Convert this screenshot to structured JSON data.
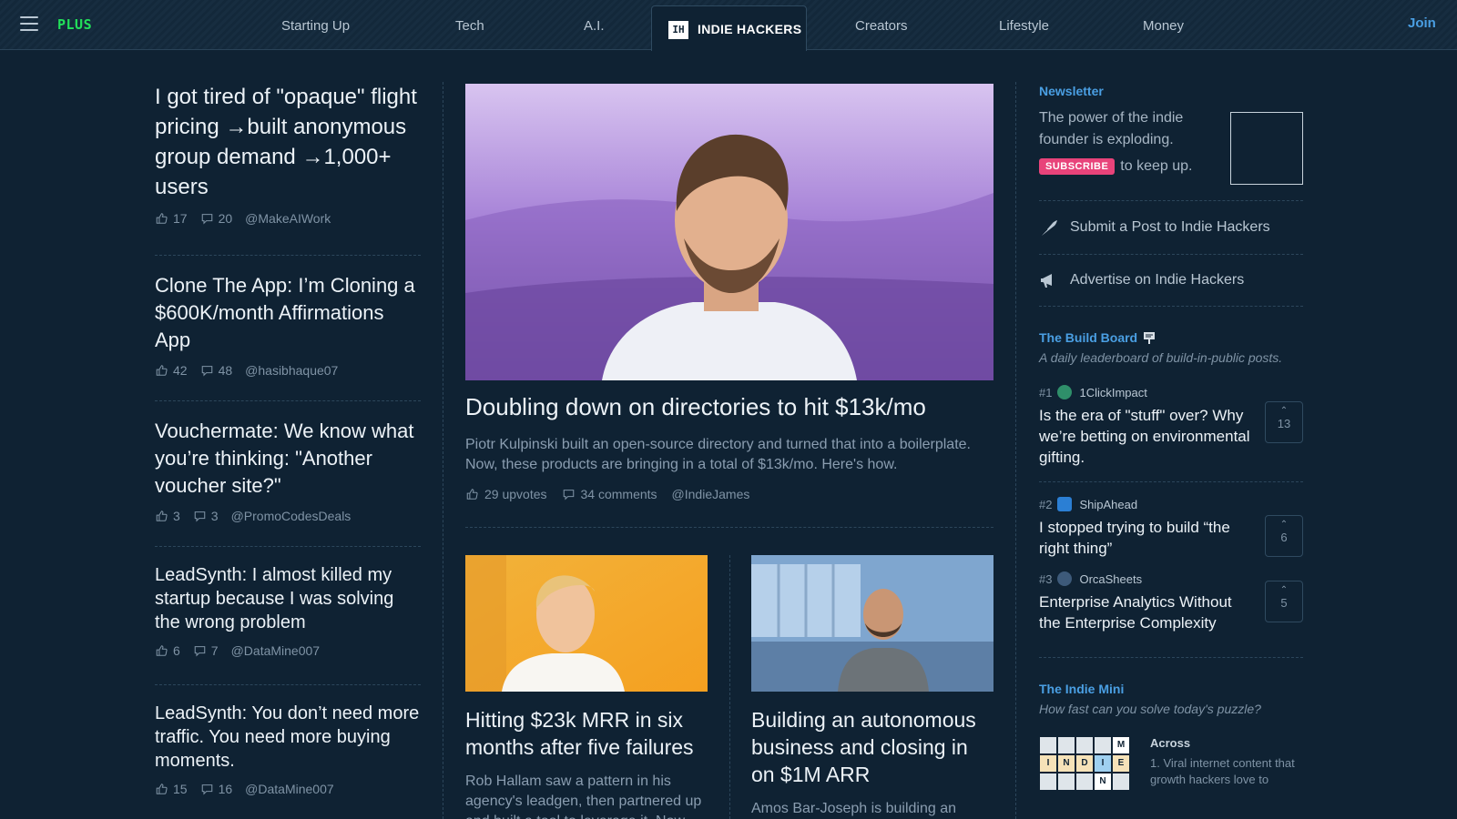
{
  "nav": {
    "plus": "PLUS",
    "items": [
      "Starting Up",
      "Tech",
      "A.I.",
      "Creators",
      "Lifestyle",
      "Money"
    ],
    "active_badge": "IH",
    "active_label": "INDIE HACKERS",
    "join": "Join"
  },
  "left_posts": [
    {
      "title": "I got tired of \"opaque\" flight pricing →built anonymous group demand →1,000+ users",
      "likes": "17",
      "comments": "20",
      "author": "@MakeAIWork"
    },
    {
      "title": "Clone The App: I’m Cloning a $600K/month Affirmations App",
      "likes": "42",
      "comments": "48",
      "author": "@hasibhaque07"
    },
    {
      "title": "Vouchermate: We know what you’re thinking: \"Another voucher site?\"",
      "likes": "3",
      "comments": "3",
      "author": "@PromoCodesDeals"
    },
    {
      "title": "LeadSynth: I almost killed my startup because I was solving the wrong problem",
      "likes": "6",
      "comments": "7",
      "author": "@DataMine007"
    },
    {
      "title": "LeadSynth: You don’t need more traffic. You need more buying moments.",
      "likes": "15",
      "comments": "16",
      "author": "@DataMine007"
    }
  ],
  "feature": {
    "title": "Doubling down on directories to hit $13k/mo",
    "desc": "Piotr Kulpinski built an open-source directory and turned that into a boilerplate. Now, these products are bringing in a total of $13k/mo. Here's how.",
    "upvotes": "29 upvotes",
    "comments": "34 comments",
    "author": "@IndieJames"
  },
  "cards": [
    {
      "title": "Hitting $23k MRR in six months after five failures",
      "desc": "Rob Hallam saw a pattern in his agency's leadgen, then partnered up and built a tool to leverage it. Now,"
    },
    {
      "title": "Building an autonomous business and closing in on $1M ARR",
      "desc": "Amos Bar-Joseph is building an"
    }
  ],
  "sidebar": {
    "newsletter_label": "Newsletter",
    "newsletter_text": "The power of the indie founder is exploding.",
    "subscribe": "SUBSCRIBE",
    "keep_up": "to keep up.",
    "submit_link": "Submit a Post to Indie Hackers",
    "advertise_link": "Advertise on Indie Hackers",
    "build_board_label": "The Build Board",
    "build_board_sub": "A daily leaderboard of build-in-public posts.",
    "build_board": [
      {
        "rank": "#1",
        "name": "1ClickImpact",
        "title": "Is the era of \"stuff\" over? Why we’re betting on environmental gifting.",
        "votes": "13",
        "logo_color": "#2f8f6a"
      },
      {
        "rank": "#2",
        "name": "ShipAhead",
        "title": "I stopped trying to build “the right thing”",
        "votes": "6",
        "logo_color": "#2b7fd4"
      },
      {
        "rank": "#3",
        "name": "OrcaSheets",
        "title": "Enterprise Analytics Without the Enterprise Complexity",
        "votes": "5",
        "logo_color": "#3d5a7a"
      }
    ],
    "mini_label": "The Indie Mini",
    "mini_sub": "How fast can you solve today's puzzle?",
    "across_label": "Across",
    "across_clue": "1. Viral internet content that growth hackers love to",
    "crossword_letters": [
      "M",
      "I",
      "N",
      "D",
      "I",
      "E",
      "N"
    ]
  },
  "colors": {
    "background": "#0f2233",
    "accent": "#4a9fe3",
    "plus": "#22e05a",
    "subscribe": "#e8437a"
  }
}
